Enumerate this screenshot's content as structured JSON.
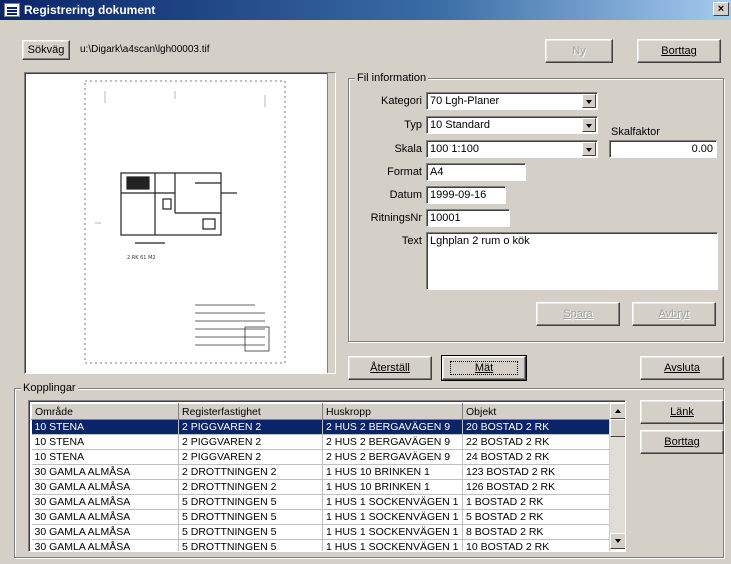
{
  "window": {
    "title": "Registrering dokument",
    "close_label": "×"
  },
  "top": {
    "path_button": "Sökväg",
    "path_value": "u:\\Digark\\a4scan\\lgh00003.tif",
    "new_button": "Ny",
    "remove_button": "Borttag"
  },
  "file_info": {
    "legend": "Fil information",
    "kategori_label": "Kategori",
    "kategori_value": "70  Lgh-Planer",
    "typ_label": "Typ",
    "typ_value": "10  Standard",
    "skala_label": "Skala",
    "skala_value": "100  1:100",
    "skalfaktor_label": "Skalfaktor",
    "skalfaktor_value": "0.00",
    "format_label": "Format",
    "format_value": "A4",
    "datum_label": "Datum",
    "datum_value": "1999-09-16",
    "ritningsnr_label": "RitningsNr",
    "ritningsnr_value": "10001",
    "text_label": "Text",
    "text_value": "Lghplan 2 rum o kök",
    "save_button": "Spara",
    "cancel_button": "Avbryt"
  },
  "actions": {
    "reset_button": "Återställ",
    "measure_button": "Mät",
    "exit_button": "Avsluta"
  },
  "links": {
    "legend": "Kopplingar",
    "link_button": "Länk",
    "remove_button": "Borttag",
    "columns": [
      "Område",
      "Registerfastighet",
      "Huskropp",
      "Objekt"
    ],
    "rows": [
      [
        "10 STENA",
        "2 PIGGVAREN 2",
        "2 HUS 2 BERGAVÄGEN 9",
        "20 BOSTAD 2 RK"
      ],
      [
        "10 STENA",
        "2 PIGGVAREN 2",
        "2 HUS 2 BERGAVÄGEN 9",
        "22 BOSTAD 2 RK"
      ],
      [
        "10 STENA",
        "2 PIGGVAREN 2",
        "2 HUS 2 BERGAVÄGEN 9",
        "24 BOSTAD 2 RK"
      ],
      [
        "30 GAMLA ALMÅSA",
        "2 DROTTNINGEN 2",
        "1 HUS 10 BRINKEN 1",
        "123 BOSTAD 2 RK"
      ],
      [
        "30 GAMLA ALMÅSA",
        "2 DROTTNINGEN 2",
        "1 HUS 10 BRINKEN 1",
        "126 BOSTAD 2 RK"
      ],
      [
        "30 GAMLA ALMÅSA",
        "5 DROTTNINGEN 5",
        "1 HUS 1 SOCKENVÄGEN 1",
        "1 BOSTAD 2 RK"
      ],
      [
        "30 GAMLA ALMÅSA",
        "5 DROTTNINGEN 5",
        "1 HUS 1 SOCKENVÄGEN 1",
        "5 BOSTAD 2 RK"
      ],
      [
        "30 GAMLA ALMÅSA",
        "5 DROTTNINGEN 5",
        "1 HUS 1 SOCKENVÄGEN 1",
        "8 BOSTAD 2 RK"
      ],
      [
        "30 GAMLA ALMÅSA",
        "5 DROTTNINGEN 5",
        "1 HUS 1 SOCKENVÄGEN 1",
        "10 BOSTAD 2 RK"
      ]
    ]
  },
  "colors": {
    "selection": "#0a246a",
    "title_gradient_start": "#0a246a",
    "window_face": "#d4d0c8"
  }
}
